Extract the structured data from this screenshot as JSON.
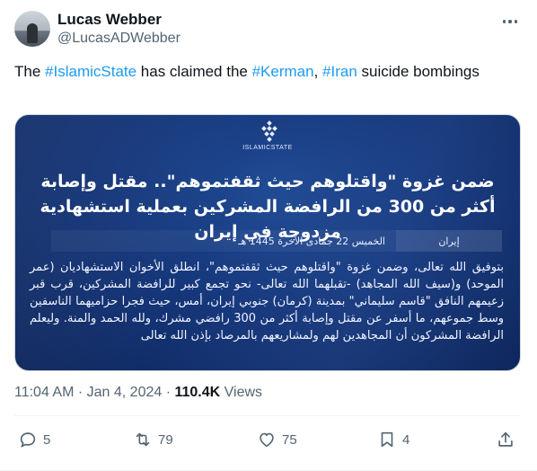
{
  "author": {
    "name": "Lucas Webber",
    "handle": "@LucasADWebber"
  },
  "tweet": {
    "text_parts": [
      {
        "t": "The ",
        "tag": false
      },
      {
        "t": "#IslamicState",
        "tag": true
      },
      {
        "t": " has claimed the ",
        "tag": false
      },
      {
        "t": "#Kerman",
        "tag": true
      },
      {
        "t": ", ",
        "tag": false
      },
      {
        "t": "#Iran",
        "tag": true
      },
      {
        "t": " suicide bombings",
        "tag": false
      }
    ]
  },
  "media": {
    "logo_caption": "ISLAMICSTATE",
    "headline": "ضمن غزوة \"واقتلوهم حيث ثقفتموهم\".. مقتل وإصابة أكثر من 300 من الرافضة المشركين بعملية استشهادية مزدوجة في إيران",
    "country": "إيران",
    "date": "الخميس 22 جمادى الآخرة 1445 هـ",
    "body": "بتوفيق الله تعالى، وضمن غزوة \"واقتلوهم حيث ثقفتموهم\"، انطلق الأخوان الاستشهاديان (عمر الموحد) و(سيف الله المجاهد) -تقبلهما الله تعالى- نحو تجمع كبير للرافضة المشركين، قرب قبر زعيمهم النافق \"قاسم سليماني\" بمدينة (كرمان) جنوبي إيران، أمس، حيث فجرا حزاميهما الناسفين وسط جموعهم، ما أسفر عن مقتل وإصابة أكثر من 300 رافضي مشرك، ولله الحمد والمنة. وليعلم الرافضة المشركون أن المجاهدين لهم ولمشاريعهم بالمرصاد بإذن الله تعالى"
  },
  "meta": {
    "time": "11:04 AM",
    "sep1": " · ",
    "date": "Jan 4, 2024",
    "sep2": " · ",
    "views_count": "110.4K",
    "views_label": " Views"
  },
  "actions": {
    "replies": "5",
    "retweets": "79",
    "likes": "75",
    "bookmarks": "4"
  },
  "icons": {
    "more": "more-icon",
    "reply": "reply-icon",
    "retweet": "retweet-icon",
    "like": "heart-icon",
    "bookmark": "bookmark-icon",
    "share": "share-icon"
  },
  "colors": {
    "link": "#1d9bf0",
    "secondary": "#536471",
    "primary": "#0f1419"
  }
}
